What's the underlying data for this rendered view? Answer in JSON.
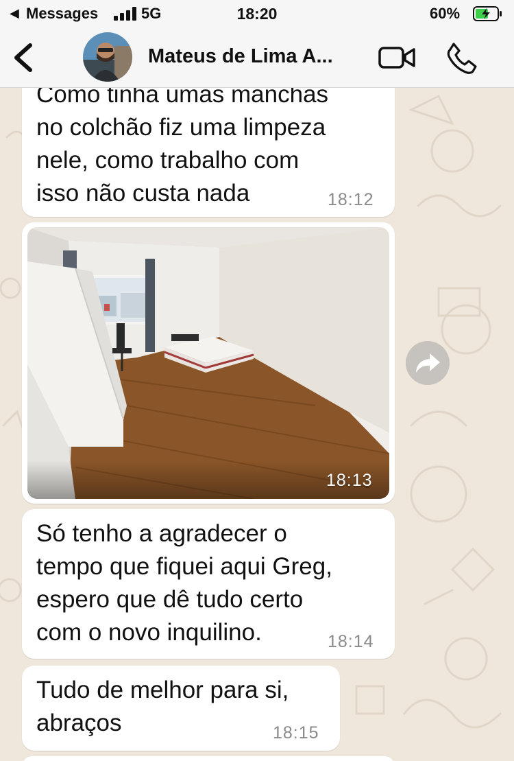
{
  "status_bar": {
    "back_app": "Messages",
    "network": "5G",
    "time": "18:20",
    "battery_percent": "60%",
    "battery_level": 0.6,
    "charging": true
  },
  "header": {
    "contact_name": "Mateus de Lima A...",
    "back_icon": "chevron-left-icon",
    "video_icon": "video-camera-icon",
    "call_icon": "phone-icon"
  },
  "messages": [
    {
      "type": "text",
      "text": "Como tinha umas manchas\nno colchão fiz uma limpeza\nnele, como trabalho com\nisso não custa nada",
      "time": "18:12"
    },
    {
      "type": "image",
      "caption_icon": "forward-icon",
      "time": "18:13"
    },
    {
      "type": "text",
      "text": "Só tenho a agradecer o\ntempo que fiquei aqui Greg,\nespero que dê tudo certo\ncom o novo inquilino.",
      "time": "18:14"
    },
    {
      "type": "text",
      "text": "Tudo de melhor para si,\nabraços",
      "time": "18:15"
    }
  ],
  "colors": {
    "wallpaper": "#efe7dc",
    "bubble": "#ffffff",
    "timestamp": "#8a8a8a",
    "battery_charging": "#3fcf4a"
  }
}
